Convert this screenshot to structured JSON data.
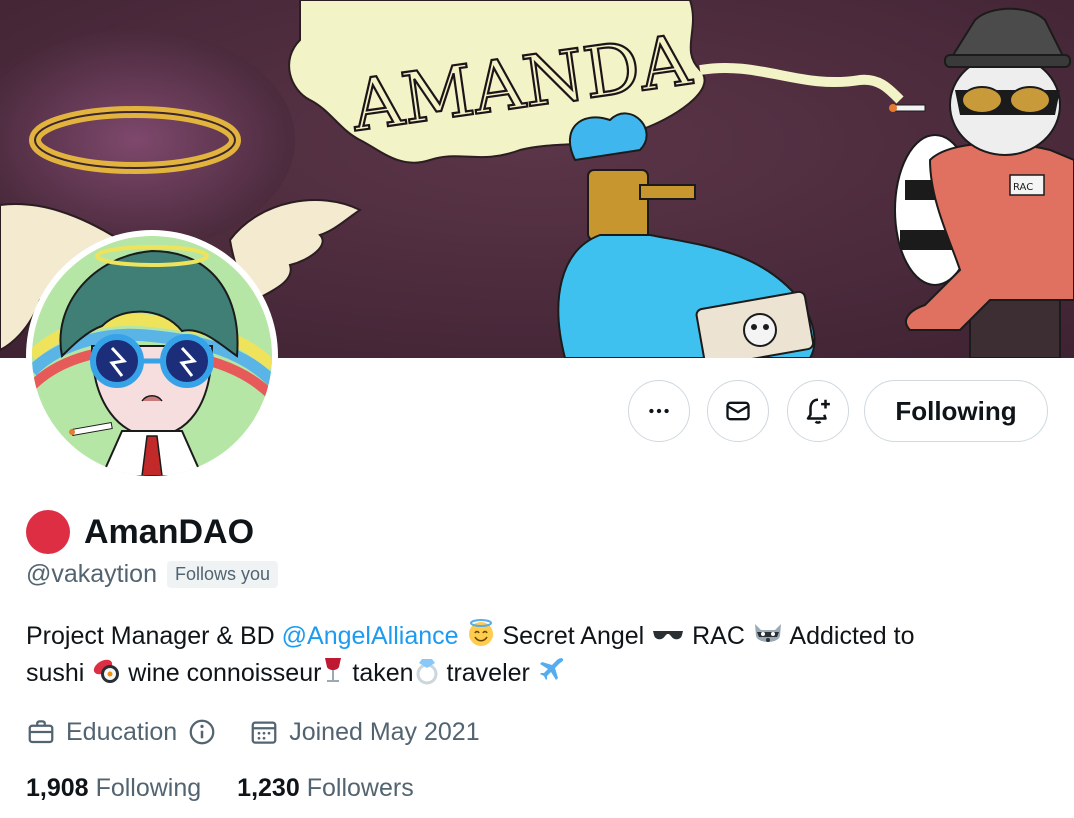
{
  "banner": {
    "lettering": "AMANDA",
    "jumpsuit_tag": "RAC"
  },
  "actions": {
    "more_icon": "ellipsis-icon",
    "message_icon": "envelope-icon",
    "notify_icon": "bell-plus-icon",
    "following_label": "Following"
  },
  "profile": {
    "display_name": "AmanDAO",
    "handle": "@vakaytion",
    "follows_you": "Follows you",
    "bio": {
      "text_1": "Project Manager & BD ",
      "mention": "@AngelAlliance",
      "text_2": " Secret Angel ",
      "text_3": " RAC ",
      "text_4": " Addicted to",
      "text_5": "sushi ",
      "text_6": " wine connoisseur",
      "text_7": " taken",
      "text_8": " traveler ",
      "emojis": [
        "angel-face",
        "sunglasses",
        "raccoon",
        "sushi",
        "wine-glass",
        "ring",
        "airplane"
      ]
    },
    "category": "Education",
    "joined": "Joined May 2021",
    "following_count": "1,908",
    "following_label": "Following",
    "followers_count": "1,230",
    "followers_label": "Followers"
  },
  "colors": {
    "accent": "#1d9bf0",
    "muted_text": "#536471",
    "primary_text": "#0f1419",
    "border": "#cfd9de",
    "status_dot": "#dd2e44",
    "banner_bg": "#4a2a3c"
  }
}
